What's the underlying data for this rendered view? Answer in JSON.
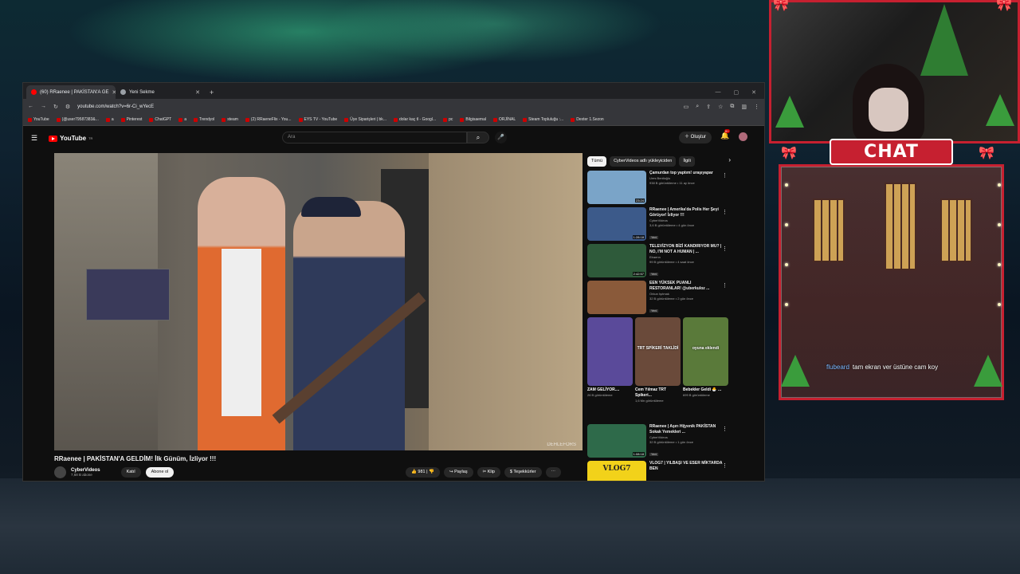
{
  "browser": {
    "tabs": [
      {
        "label": "(60) RRaenee | PAKİSTAN'A GE",
        "active": true
      },
      {
        "label": "Yeni Sekme",
        "active": false
      }
    ],
    "url": "youtube.com/watch?v=6r-Ci_wYecE",
    "bookmarks": [
      "YouTube",
      "(@user79587383&...",
      "a",
      "Pinterest",
      "ChatGPT",
      "a",
      "Trendyol",
      "steam",
      "(2) RRaeneFlix - You...",
      "EYS TV - YouTube",
      "Üye Siparişleri | bk...",
      "dolar kaç tl - Googl...",
      "pc",
      "Bilgisaemal",
      "ORJİNAL",
      "Steam Topluluğu :...",
      "Dexter 1.Sezon"
    ]
  },
  "youtube": {
    "logo": "YouTube",
    "logo_country": "TR",
    "search_placeholder": "Ara",
    "create_label": "Oluştur",
    "notif_count": "9+",
    "video": {
      "title": "RRaenee | PAKİSTAN'A GELDİM! İlk Günüm, İzliyor !!!",
      "channel": "CyberVideos",
      "subs": "7,68 B abone",
      "join_label": "Katıl",
      "subscribe_label": "Abone ol",
      "likes": "981",
      "share_label": "Paylaş",
      "clip_label": "Klip",
      "thanks_label": "Teşekkürler",
      "watermark": "DEHLEFORS"
    },
    "chips": [
      "Tümü",
      "CyberVideos adlı yükleyiciden",
      "İlgili"
    ],
    "recommendations": [
      {
        "title": "Çamurdan top yaptım! uraşıyapar",
        "channel": "Ures Benlioğlu",
        "meta": "938 B görüntüleme • 11 ay önce",
        "duration": "23:24",
        "color": "#7aa4c8",
        "new": ""
      },
      {
        "title": "RRaenee | Amerika'da Polis Her Şeyi Görüyor! İzliyor !!!",
        "channel": "CyberVideos",
        "meta": "3,6 B görüntüleme • 4 gün önce",
        "duration": "1:28:18",
        "color": "#3c5a8a",
        "new": "Yeni"
      },
      {
        "title": "TELEVİZYON BİZİ KANDIRIYOR MU? | NO, I'M NOT A HUMAN | ...",
        "channel": "Elraenn",
        "meta": "99 B görüntüleme • 4 saat önce",
        "duration": "2:42:57",
        "color": "#2e5a3a",
        "new": "Yeni"
      },
      {
        "title": "EEN YÜKSEK PUANLI RESTORANLAR! @uberkuloz ...",
        "channel": "Orkun Işıtmak",
        "meta": "32 B görüntüleme • 2 gün önce",
        "duration": "",
        "color": "#8a5a3a",
        "new": "Yeni"
      }
    ],
    "shorts": [
      {
        "title": "ZAM GELİYOR....",
        "meta": "26 B görüntüleme",
        "color": "#5a4a9a"
      },
      {
        "title": "Cem Yılmaz TRT Spikeri...",
        "meta": "1,6 Mn görüntüleme",
        "color": "#6a4a3a",
        "overlay": "TRT SPİKERİ TAKLİDİ"
      },
      {
        "title": "Bebekler Geldi 🐣 ...",
        "meta": "699 B görüntüleme",
        "color": "#5a7a3a",
        "overlay": "oyuna eklendi"
      }
    ],
    "recommendations2": [
      {
        "title": "RRaenee | Aşırı Hijyenik PAKİSTAN Sokak Yemekleri ...",
        "channel": "CyberVideos",
        "meta": "32 B görüntüleme • 1 gün önce",
        "duration": "1:08:18",
        "color": "#2e6a4a",
        "new": "Yeni"
      },
      {
        "title": "VLOG7 | YILBAŞI VE ESER MİKTARDA BEN",
        "channel": "",
        "meta": "",
        "duration": "",
        "color": "#f2d21a",
        "new": "",
        "thumb_text": "VLOG7"
      }
    ]
  },
  "stream": {
    "chat_title": "CHAT",
    "chat_messages": [
      {
        "user": "flubeard",
        "text": "tam ekran ver üstüne cam koy"
      }
    ]
  }
}
